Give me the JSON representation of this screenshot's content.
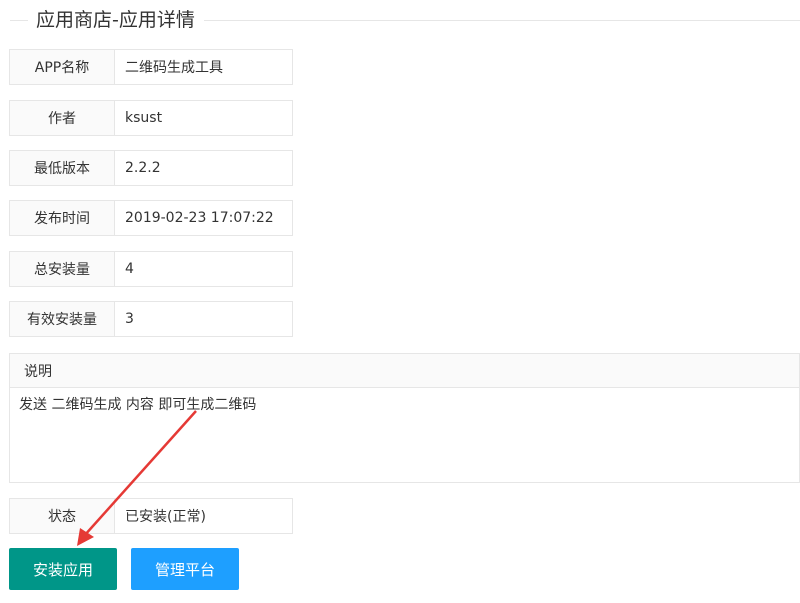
{
  "page": {
    "title": "应用商店-应用详情"
  },
  "fields": [
    {
      "label": "APP名称",
      "value": "二维码生成工具"
    },
    {
      "label": "作者",
      "value": "ksust"
    },
    {
      "label": "最低版本",
      "value": "2.2.2"
    },
    {
      "label": "发布时间",
      "value": "2019-02-23 17:07:22"
    },
    {
      "label": "总安装量",
      "value": "4"
    },
    {
      "label": "有效安装量",
      "value": "3"
    }
  ],
  "description": {
    "label": "说明",
    "text": "发送 二维码生成 内容 即可生成二维码"
  },
  "status": {
    "label": "状态",
    "value": "已安装(正常)"
  },
  "buttons": {
    "install_label": "安装应用",
    "manage_label": "管理平台"
  },
  "colors": {
    "install_button": "#009688",
    "manage_button": "#1e9fff",
    "annotation_arrow": "#e53935"
  }
}
